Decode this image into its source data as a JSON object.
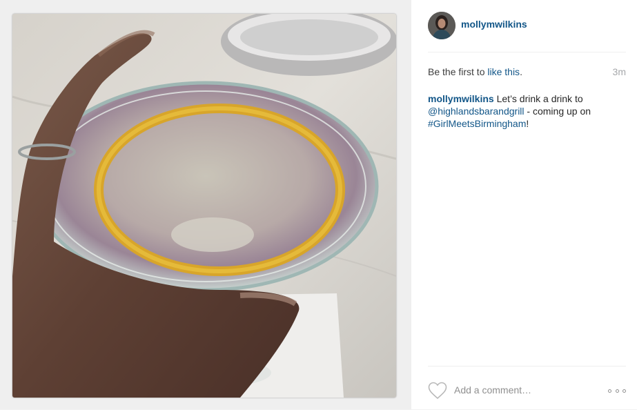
{
  "post": {
    "username": "mollymwilkins",
    "likes_prefix": "Be the first to ",
    "likes_link": "like this",
    "likes_suffix": ".",
    "time": "3m",
    "caption": {
      "user": "mollymwilkins",
      "text1": " Let’s drink a drink to ",
      "mention": "@highlandsbarandgrill",
      "text2": " - coming up on ",
      "hashtag": "#GirlMeetsBirmingham",
      "text3": "!"
    }
  },
  "footer": {
    "comment_placeholder": "Add a comment…",
    "like_icon": "heart-icon",
    "more_icon": "more-options-icon"
  },
  "colors": {
    "link": "#125688",
    "text": "#262626",
    "muted": "#a5a7aa"
  }
}
